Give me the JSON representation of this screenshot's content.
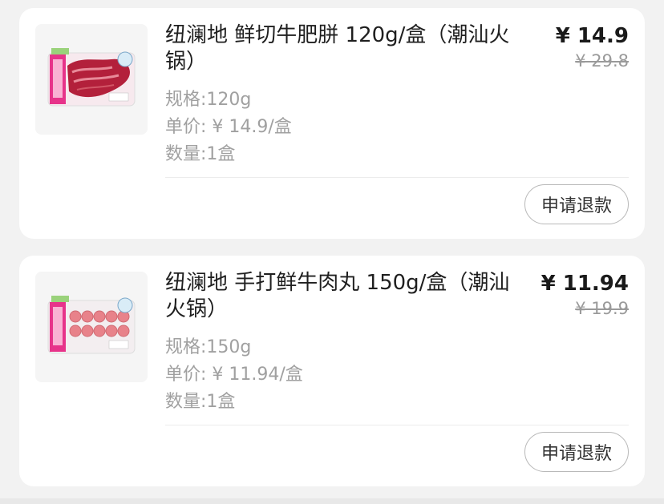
{
  "items": [
    {
      "title": "纽澜地 鲜切牛肥胼 120g/盒（潮汕火锅）",
      "price": "¥ 14.9",
      "original_price": "¥ 29.8",
      "spec": "规格:120g",
      "unit_price": "单价: ¥ 14.9/盒",
      "quantity": "数量:1盒",
      "refund_label": "申请退款"
    },
    {
      "title": "纽澜地 手打鲜牛肉丸 150g/盒（潮汕火锅）",
      "price": "¥ 11.94",
      "original_price": "¥ 19.9",
      "spec": "规格:150g",
      "unit_price": "单价: ¥ 11.94/盒",
      "quantity": "数量:1盒",
      "refund_label": "申请退款"
    }
  ],
  "colors": {
    "background": "#f2f2f2",
    "card": "#ffffff",
    "meta_text": "#a0a0a0",
    "strike_price": "#9a9a9a",
    "brand_pink": "#e7338a"
  },
  "icons": [
    "beef-slices-package-image",
    "beef-balls-package-image"
  ]
}
